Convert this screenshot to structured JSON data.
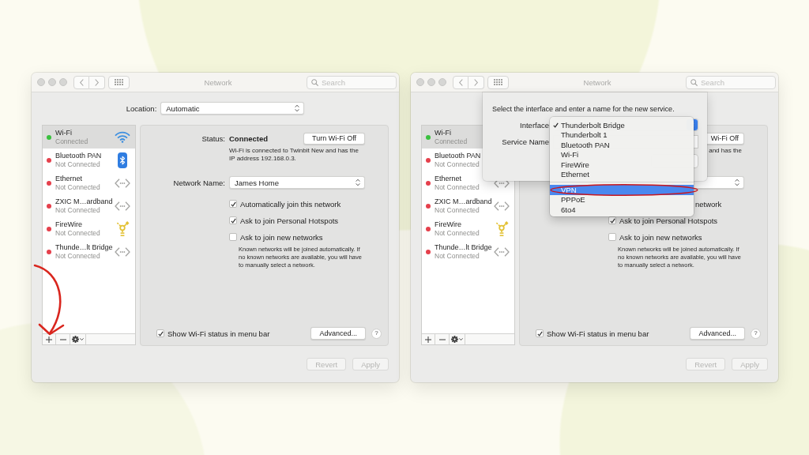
{
  "windows": [
    {
      "title": "Network",
      "search": {
        "placeholder": "Search"
      },
      "location": {
        "label": "Location:",
        "value": "Automatic"
      },
      "services": [
        {
          "name": "Wi-Fi",
          "status": "Connected",
          "color": "#3ac13f",
          "kind": "wifi",
          "selected": true
        },
        {
          "name": "Bluetooth PAN",
          "status": "Not Connected",
          "color": "#e5404c",
          "kind": "bluetooth",
          "selected": false
        },
        {
          "name": "Ethernet",
          "status": "Not Connected",
          "color": "#e5404c",
          "kind": "ethernet",
          "selected": false
        },
        {
          "name": "ZXIC M…ardband",
          "status": "Not Connected",
          "color": "#e5404c",
          "kind": "ethernet",
          "selected": false
        },
        {
          "name": "FireWire",
          "status": "Not Connected",
          "color": "#e5404c",
          "kind": "firewire",
          "selected": false
        },
        {
          "name": "Thunde…lt Bridge",
          "status": "Not Connected",
          "color": "#e5404c",
          "kind": "ethernet",
          "selected": false
        }
      ],
      "panel": {
        "status": {
          "label": "Status:",
          "value": "Connected"
        },
        "toggle_button": "Turn Wi-Fi Off",
        "description": "Wi-Fi is connected to Twinbit New and has the IP address 192.168.0.3.",
        "network_name": {
          "label": "Network Name:",
          "value": "James Home"
        },
        "options": [
          {
            "label": "Automatically join this network",
            "checked": true
          },
          {
            "label": "Ask to join Personal Hotspots",
            "checked": true
          },
          {
            "label": "Ask to join new networks",
            "checked": false
          }
        ],
        "note": "Known networks will be joined automatically. If no known networks are available, you will have to manually select a network.",
        "menu_bar_option": {
          "label": "Show Wi-Fi status in menu bar",
          "checked": true
        },
        "advanced_button": "Advanced...",
        "help_button": "?"
      },
      "footer": [
        {
          "label": "Revert",
          "disabled": true
        },
        {
          "label": "Apply",
          "disabled": true
        }
      ],
      "annotation": {
        "kind": "arrow"
      }
    },
    {
      "title": "Network",
      "search": {
        "placeholder": "Search"
      },
      "services": [
        {
          "name": "Wi-Fi",
          "status": "Connected",
          "color": "#3ac13f",
          "selected": true
        },
        {
          "name": "Bluetooth PAN",
          "status": "Not Connected",
          "color": "#e5404c",
          "selected": false
        },
        {
          "name": "Ethernet",
          "status": "Not Connected",
          "color": "#e5404c",
          "kind": "ethernet",
          "selected": false
        },
        {
          "name": "ZXIC M…ardband",
          "status": "Not Connected",
          "color": "#e5404c",
          "kind": "ethernet",
          "selected": false
        },
        {
          "name": "FireWire",
          "status": "Not Connected",
          "color": "#e5404c",
          "kind": "firewire",
          "selected": false
        },
        {
          "name": "Thunde…lt Bridge",
          "status": "Not Connected",
          "color": "#e5404c",
          "kind": "ethernet",
          "selected": false
        }
      ],
      "panel": {
        "toggle_button": "Wi-Fi Off",
        "description": "and has the",
        "options": [
          {
            "label": "network"
          },
          {
            "label": "Ask to join Personal Hotspots",
            "checked": true
          },
          {
            "label": "Ask to join new networks",
            "checked": false
          }
        ],
        "note": "Known networks will be joined automatically. If no known networks are available, you will have to manually select a network.",
        "menu_bar_option": {
          "label": "Show Wi-Fi status in menu bar",
          "checked": true
        },
        "advanced_button": "Advanced...",
        "help_button": "?"
      },
      "footer": [
        {
          "label": "Revert",
          "disabled": true
        },
        {
          "label": "Apply",
          "disabled": true
        }
      ],
      "sheet": {
        "message": "Select the interface and enter a name for the new service.",
        "fields": [
          {
            "kind": "popup",
            "label": "Interface"
          },
          {
            "kind": "text",
            "label": "Service Name"
          }
        ],
        "menu": [
          {
            "kind": "item",
            "label": "Thunderbolt Bridge",
            "checked": true,
            "selected": false,
            "circled": false
          },
          {
            "kind": "item",
            "label": "Thunderbolt 1",
            "checked": false,
            "selected": false,
            "circled": false
          },
          {
            "kind": "item",
            "label": "Bluetooth PAN",
            "checked": false,
            "selected": false,
            "circled": false
          },
          {
            "kind": "item",
            "label": "Wi-Fi",
            "checked": false,
            "selected": false,
            "circled": false
          },
          {
            "kind": "item",
            "label": "FireWire",
            "checked": false,
            "selected": false,
            "circled": false
          },
          {
            "kind": "item",
            "label": "Ethernet",
            "checked": false,
            "selected": false,
            "circled": false
          },
          {
            "kind": "separator"
          },
          {
            "kind": "item",
            "label": "VPN",
            "checked": false,
            "selected": true,
            "circled": true
          },
          {
            "kind": "item",
            "label": "PPPoE",
            "checked": false,
            "selected": false,
            "circled": false
          },
          {
            "kind": "item",
            "label": "6to4",
            "checked": false,
            "selected": false,
            "circled": false
          }
        ]
      }
    }
  ]
}
